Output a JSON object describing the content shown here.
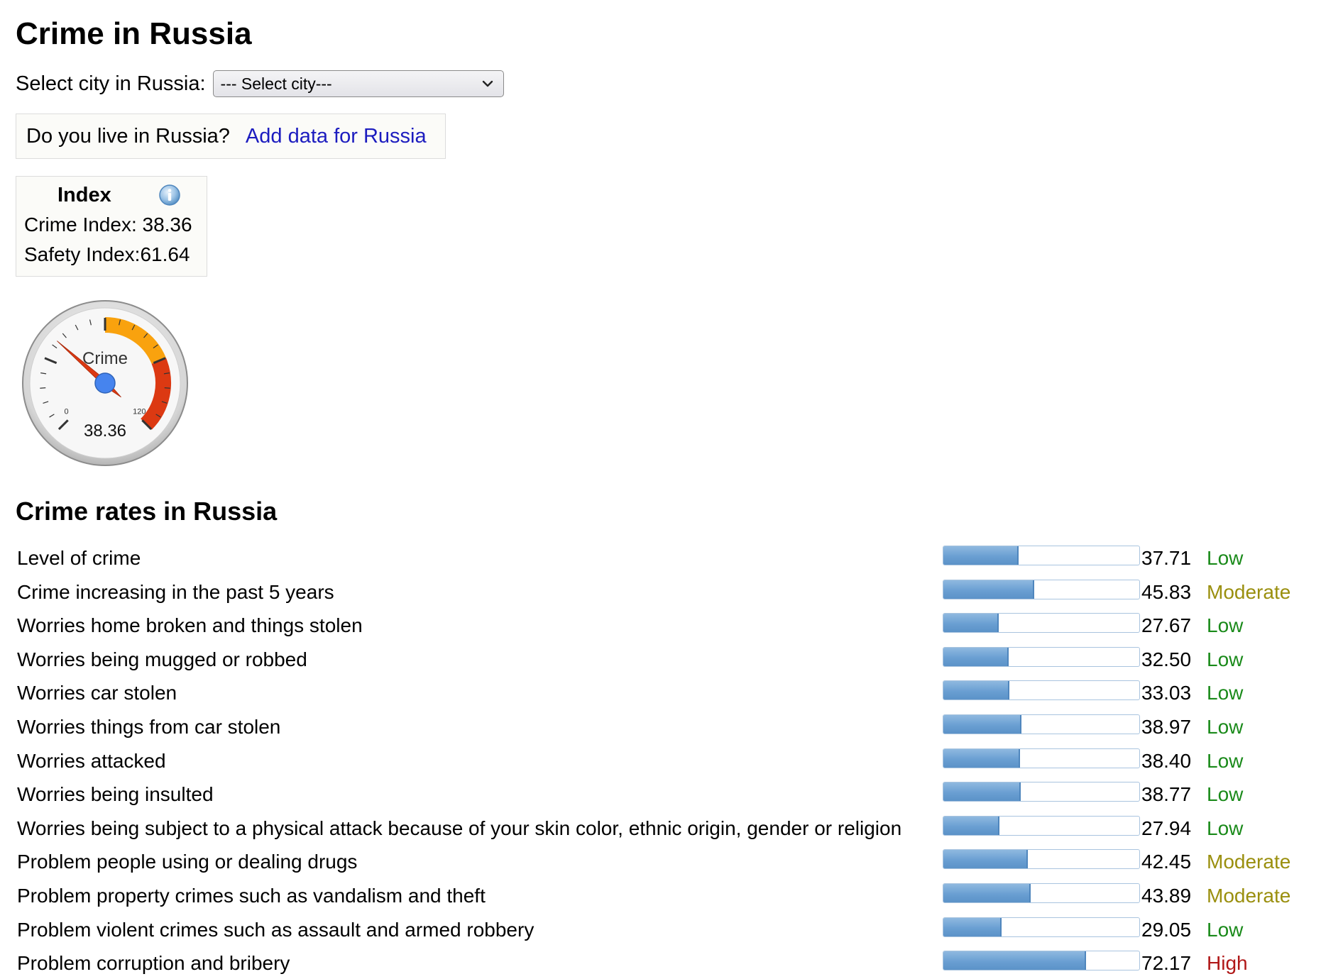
{
  "page": {
    "title": "Crime in Russia",
    "select_label": "Select city in Russia:",
    "select_value": "--- Select city---",
    "live_question": "Do you live in Russia?",
    "add_data_link": "Add data for Russia"
  },
  "index": {
    "heading": "Index",
    "crime_label": "Crime Index:",
    "crime_value": "38.36",
    "safety_label": "Safety Index:",
    "safety_value": "61.64"
  },
  "gauge": {
    "label": "Crime",
    "value": 38.36,
    "display_value": "38.36",
    "min": 0,
    "max": 120,
    "min_label": "0",
    "max_label": "120",
    "colors": {
      "orange": "#f9a20e",
      "red": "#dc3912",
      "needle": "#dc3912",
      "hub": "#4684ee"
    }
  },
  "rates": {
    "heading": "Crime rates in Russia",
    "colors": {
      "Low": "#1a8a1a",
      "Moderate": "#9a8f0e",
      "High": "#b01818",
      "bar": "#6a9fd2"
    },
    "items": [
      {
        "label": "Level of crime",
        "value": "37.71",
        "level": "Low"
      },
      {
        "label": "Crime increasing in the past 5 years",
        "value": "45.83",
        "level": "Moderate"
      },
      {
        "label": "Worries home broken and things stolen",
        "value": "27.67",
        "level": "Low"
      },
      {
        "label": "Worries being mugged or robbed",
        "value": "32.50",
        "level": "Low"
      },
      {
        "label": "Worries car stolen",
        "value": "33.03",
        "level": "Low"
      },
      {
        "label": "Worries things from car stolen",
        "value": "38.97",
        "level": "Low"
      },
      {
        "label": "Worries attacked",
        "value": "38.40",
        "level": "Low"
      },
      {
        "label": "Worries being insulted",
        "value": "38.77",
        "level": "Low"
      },
      {
        "label": "Worries being subject to a physical attack because of your skin color, ethnic origin, gender or religion",
        "value": "27.94",
        "level": "Low"
      },
      {
        "label": "Problem people using or dealing drugs",
        "value": "42.45",
        "level": "Moderate"
      },
      {
        "label": "Problem property crimes such as vandalism and theft",
        "value": "43.89",
        "level": "Moderate"
      },
      {
        "label": "Problem violent crimes such as assault and armed robbery",
        "value": "29.05",
        "level": "Low"
      },
      {
        "label": "Problem corruption and bribery",
        "value": "72.17",
        "level": "High"
      }
    ]
  }
}
